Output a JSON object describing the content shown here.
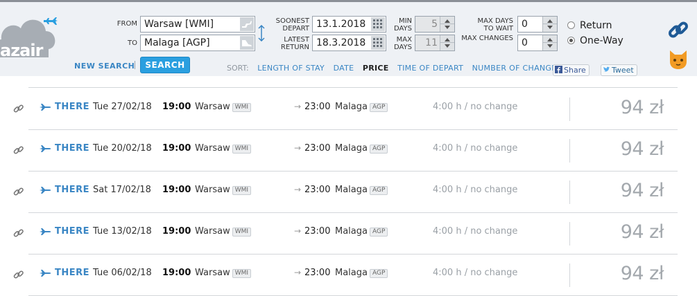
{
  "logo": {
    "text": "azair"
  },
  "search": {
    "from_label": "FROM",
    "from_value": "Warsaw [WMI]",
    "to_label": "TO",
    "to_value": "Malaga [AGP]",
    "soonest_depart_label_1": "SOONEST",
    "soonest_depart_label_2": "DEPART",
    "soonest_depart": "13.1.2018",
    "latest_return_label_1": "LATEST",
    "latest_return_label_2": "RETURN",
    "latest_return": "18.3.2018",
    "min_days_label_1": "MIN",
    "min_days_label_2": "DAYS",
    "min_days": "5",
    "max_days_label_1": "MAX",
    "max_days_label_2": "DAYS",
    "max_days": "11",
    "max_days_wait_label_1": "MAX DAYS",
    "max_days_wait_label_2": "TO WAIT",
    "max_days_wait": "0",
    "max_changes_label": "MAX CHANGES",
    "max_changes": "0",
    "trip_return_label": "Return",
    "trip_oneway_label": "One-Way",
    "trip_selected": "One-Way",
    "new_search_label": "NEW SEARCH",
    "search_button_label": "SEARCH"
  },
  "sort": {
    "label": "SORT:",
    "options": [
      "LENGTH OF STAY",
      "DATE",
      "PRICE",
      "TIME OF DEPART",
      "NUMBER OF CHANGES"
    ],
    "active": "PRICE"
  },
  "social": {
    "share_label": "Share",
    "tweet_label": "Tweet"
  },
  "colors": {
    "accent": "#2a9fe0",
    "link": "#3a86c4",
    "header_bg": "#eef1f5"
  },
  "results": [
    {
      "direction": "THERE",
      "date": "Tue 27/02/18",
      "depart_time": "19:00",
      "from_city": "Warsaw",
      "from_code": "WMI",
      "arrive_time": "23:00",
      "to_city": "Malaga",
      "to_code": "AGP",
      "duration": "4:00 h / no change",
      "price": "94 zł"
    },
    {
      "direction": "THERE",
      "date": "Tue 20/02/18",
      "depart_time": "19:00",
      "from_city": "Warsaw",
      "from_code": "WMI",
      "arrive_time": "23:00",
      "to_city": "Malaga",
      "to_code": "AGP",
      "duration": "4:00 h / no change",
      "price": "94 zł"
    },
    {
      "direction": "THERE",
      "date": "Sat 17/02/18",
      "depart_time": "19:00",
      "from_city": "Warsaw",
      "from_code": "WMI",
      "arrive_time": "23:00",
      "to_city": "Malaga",
      "to_code": "AGP",
      "duration": "4:00 h / no change",
      "price": "94 zł"
    },
    {
      "direction": "THERE",
      "date": "Tue 13/02/18",
      "depart_time": "19:00",
      "from_city": "Warsaw",
      "from_code": "WMI",
      "arrive_time": "23:00",
      "to_city": "Malaga",
      "to_code": "AGP",
      "duration": "4:00 h / no change",
      "price": "94 zł"
    },
    {
      "direction": "THERE",
      "date": "Tue 06/02/18",
      "depart_time": "19:00",
      "from_city": "Warsaw",
      "from_code": "WMI",
      "arrive_time": "23:00",
      "to_city": "Malaga",
      "to_code": "AGP",
      "duration": "4:00 h / no change",
      "price": "94 zł"
    }
  ]
}
